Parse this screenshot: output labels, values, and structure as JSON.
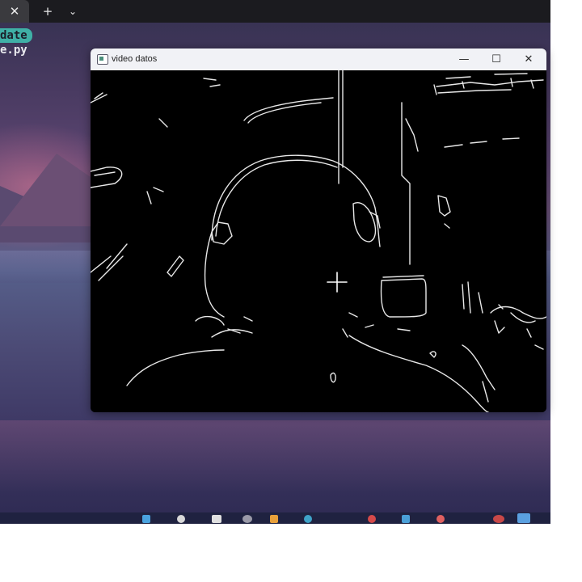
{
  "terminal": {
    "tab_close": "✕",
    "new_tab": "+",
    "dropdown": "⌄",
    "line_update": "date",
    "line_file": "e.py"
  },
  "window": {
    "title": "video datos",
    "minimize": "—",
    "maximize": "☐",
    "close": "✕"
  },
  "colors": {
    "terminal_highlight": "#3fb0a6",
    "titlebar": "#f1f2f6",
    "video_bg": "#000000",
    "edge_lines": "#e8e8e8"
  },
  "taskbar": {
    "icons": [
      "explorer-icon",
      "chrome-icon",
      "app-icon",
      "terminal-icon",
      "python-icon",
      "vscode-icon",
      "app-icon",
      "app-icon"
    ]
  }
}
